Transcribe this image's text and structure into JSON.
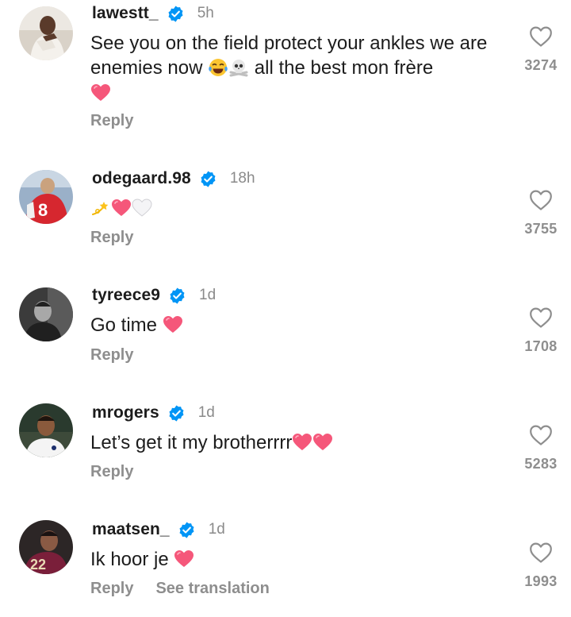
{
  "comments": [
    {
      "username": "lawestt_",
      "verified": true,
      "time": "5h",
      "text_part1": "See you on the field protect your ankles we are enemies now",
      "text_part2": "all the best mon frère",
      "emojis": [
        "face-with-tears-of-joy",
        "skull-and-crossbones",
        "pink-heart"
      ],
      "reply_label": "Reply",
      "like_count": "3274"
    },
    {
      "username": "odegaard.98",
      "verified": true,
      "time": "18h",
      "text_part1": "",
      "emojis": [
        "dizzy",
        "red-heart",
        "white-heart"
      ],
      "reply_label": "Reply",
      "like_count": "3755"
    },
    {
      "username": "tyreece9",
      "verified": true,
      "time": "1d",
      "text_part1": "Go time",
      "emojis": [
        "red-heart"
      ],
      "reply_label": "Reply",
      "like_count": "1708"
    },
    {
      "username": "mrogers",
      "verified": true,
      "time": "1d",
      "text_part1": "Let’s get it my brotherrrr",
      "emojis": [
        "red-heart",
        "red-heart"
      ],
      "reply_label": "Reply",
      "like_count": "5283"
    },
    {
      "username": "maatsen_",
      "verified": true,
      "time": "1d",
      "text_part1": "Ik hoor je",
      "emojis": [
        "red-heart"
      ],
      "reply_label": "Reply",
      "see_translation_label": "See translation",
      "like_count": "1993"
    }
  ],
  "colors": {
    "verified_blue": "#0095f6",
    "muted_gray": "#8e8e8e",
    "heart_pink": "#f5577a"
  }
}
